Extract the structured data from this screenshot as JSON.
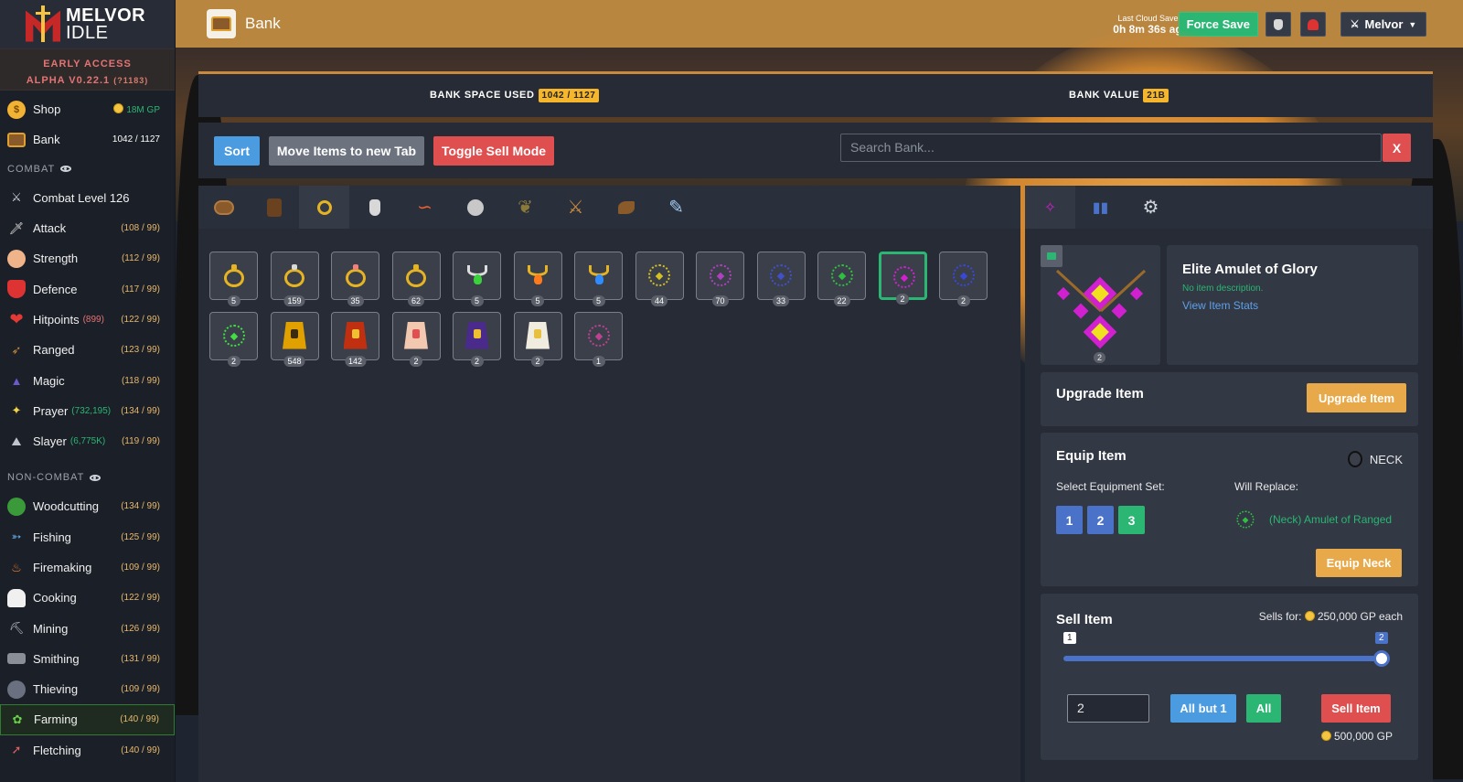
{
  "logo": {
    "line1": "MELVOR",
    "line2": "IDLE"
  },
  "sidebar": {
    "early_access": "EARLY ACCESS",
    "version": "ALPHA V0.22.1",
    "build": "(?1183)",
    "shop": {
      "label": "Shop",
      "value": "18M GP"
    },
    "bank": {
      "label": "Bank",
      "value": "1042 / 1127"
    },
    "combat_header": "COMBAT",
    "combat_level": "Combat Level 126",
    "combat": [
      {
        "label": "Attack",
        "level": "(108 / 99)",
        "xp": ""
      },
      {
        "label": "Strength",
        "level": "(112 / 99)",
        "xp": ""
      },
      {
        "label": "Defence",
        "level": "(117 / 99)",
        "xp": ""
      },
      {
        "label": "Hitpoints",
        "level": "(122 / 99)",
        "xp": "(899)"
      },
      {
        "label": "Ranged",
        "level": "(123 / 99)",
        "xp": ""
      },
      {
        "label": "Magic",
        "level": "(118 / 99)",
        "xp": ""
      },
      {
        "label": "Prayer",
        "level": "(134 / 99)",
        "xp": "(732,195)"
      },
      {
        "label": "Slayer",
        "level": "(119 / 99)",
        "xp": "(6,775K)"
      }
    ],
    "noncombat_header": "NON-COMBAT",
    "noncombat": [
      {
        "label": "Woodcutting",
        "level": "(134 / 99)"
      },
      {
        "label": "Fishing",
        "level": "(125 / 99)"
      },
      {
        "label": "Firemaking",
        "level": "(109 / 99)"
      },
      {
        "label": "Cooking",
        "level": "(122 / 99)"
      },
      {
        "label": "Mining",
        "level": "(126 / 99)"
      },
      {
        "label": "Smithing",
        "level": "(131 / 99)"
      },
      {
        "label": "Thieving",
        "level": "(109 / 99)"
      },
      {
        "label": "Farming",
        "level": "(140 / 99)"
      },
      {
        "label": "Fletching",
        "level": "(140 / 99)"
      }
    ]
  },
  "header": {
    "title": "Bank",
    "cloud_label": "Last Cloud Save",
    "cloud_time": "0h 8m 36s ago",
    "force_save": "Force Save",
    "user": "Melvor"
  },
  "bank": {
    "space_label": "BANK SPACE USED",
    "space_value": "1042 / 1127",
    "value_label": "BANK VALUE",
    "value_value": "21B",
    "sort": "Sort",
    "move": "Move Items to new Tab",
    "toggle_sell": "Toggle Sell Mode",
    "search_placeholder": "Search Bank...",
    "search_clear": "X",
    "items": [
      {
        "kind": "ring",
        "gem": "#e6b422",
        "qty": "5"
      },
      {
        "kind": "ring",
        "gem": "#d9d9d9",
        "qty": "159"
      },
      {
        "kind": "ring",
        "gem": "#f08080",
        "qty": "35"
      },
      {
        "kind": "ring",
        "gem": "#e6b422",
        "qty": "62"
      },
      {
        "kind": "neck",
        "color": "#dddddd",
        "gem": "#3ad23a",
        "qty": "5"
      },
      {
        "kind": "neck",
        "color": "#e6b422",
        "gem": "#ff7a1a",
        "qty": "5"
      },
      {
        "kind": "neck",
        "color": "#e6b422",
        "gem": "#2f8cff",
        "qty": "5"
      },
      {
        "kind": "amulet",
        "color": "#d4c020",
        "qty": "44"
      },
      {
        "kind": "amulet",
        "color": "#b040c0",
        "qty": "70"
      },
      {
        "kind": "amulet",
        "color": "#4050c8",
        "qty": "33"
      },
      {
        "kind": "amulet",
        "color": "#30c040",
        "qty": "22"
      },
      {
        "kind": "amulet",
        "color": "#d020d0",
        "qty": "2",
        "selected": true
      },
      {
        "kind": "amulet",
        "color": "#3848d8",
        "qty": "2"
      },
      {
        "kind": "amulet",
        "color": "#40e040",
        "qty": "2"
      },
      {
        "kind": "cape",
        "color": "#e0a000",
        "accent": "#3a2a10",
        "qty": "548"
      },
      {
        "kind": "cape",
        "color": "#c03010",
        "accent": "#f0c030",
        "qty": "142"
      },
      {
        "kind": "cape",
        "color": "#f2c8b0",
        "accent": "#e05050",
        "qty": "2"
      },
      {
        "kind": "cape",
        "color": "#4a2a8a",
        "accent": "#f0c030",
        "qty": "2"
      },
      {
        "kind": "cape",
        "color": "#f0ece0",
        "accent": "#e8c040",
        "qty": "2"
      },
      {
        "kind": "amulet",
        "color": "#c04090",
        "qty": "1"
      }
    ]
  },
  "item_panel": {
    "name": "Elite Amulet of Glory",
    "description": "No item description.",
    "view_stats": "View Item Stats",
    "qty": "2",
    "upgrade_title": "Upgrade Item",
    "upgrade_btn": "Upgrade Item",
    "equip_title": "Equip Item",
    "equip_slot": "NECK",
    "select_set": "Select Equipment Set:",
    "sets": [
      "1",
      "2",
      "3"
    ],
    "will_replace": "Will Replace:",
    "replace_item": "(Neck) Amulet of Ranged",
    "equip_btn": "Equip Neck",
    "sell_title": "Sell Item",
    "sells_for_label": "Sells for:",
    "sells_for_value": "250,000 GP each",
    "slider_min": "1",
    "slider_max": "2",
    "sell_qty": "2",
    "all_but_one": "All but 1",
    "all": "All",
    "sell_btn": "Sell Item",
    "total": "500,000 GP"
  },
  "colors": {
    "accent": "#b98640",
    "green": "#2bb673",
    "red": "#e04f4f",
    "blue": "#4a72c9",
    "gold": "#f5b62b"
  }
}
